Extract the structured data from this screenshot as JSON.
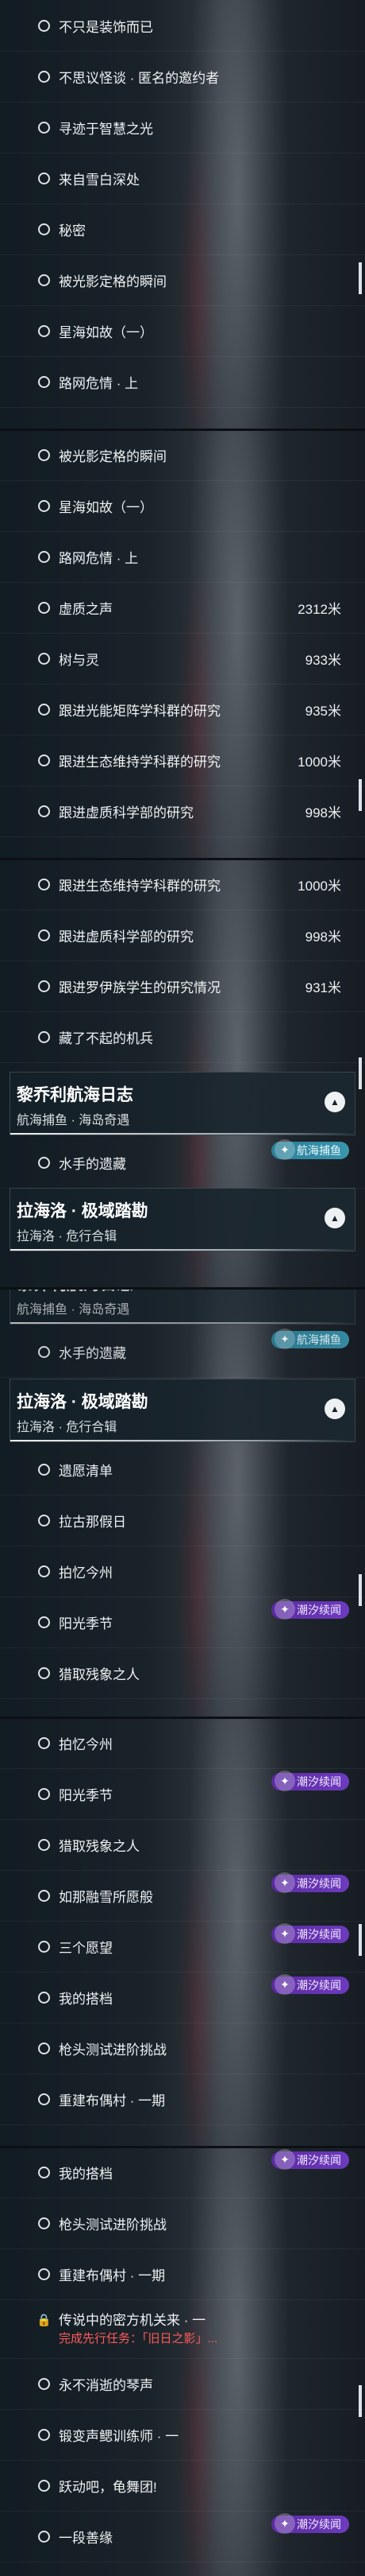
{
  "screens": [
    {
      "items": [
        {
          "label": "不只是装饰而已"
        },
        {
          "label": "不思议怪谈 · 匿名的邀约者"
        },
        {
          "label": "寻迹于智慧之光"
        },
        {
          "label": "来自雪白深处"
        },
        {
          "label": "秘密"
        },
        {
          "label": "被光影定格的瞬间"
        },
        {
          "label": "星海如故（一）"
        },
        {
          "label": "路网危情 · 上"
        }
      ]
    },
    {
      "items": [
        {
          "label": "被光影定格的瞬间"
        },
        {
          "label": "星海如故（一）"
        },
        {
          "label": "路网危情 · 上"
        },
        {
          "label": "虚质之声",
          "distance": "2312米"
        },
        {
          "label": "树与灵",
          "distance": "933米"
        },
        {
          "label": "跟进光能矩阵学科群的研究",
          "distance": "935米"
        },
        {
          "label": "跟进生态维持学科群的研究",
          "distance": "1000米"
        },
        {
          "label": "跟进虚质科学部的研究",
          "distance": "998米"
        }
      ]
    },
    {
      "items": [
        {
          "label": "跟进生态维持学科群的研究",
          "distance": "1000米"
        },
        {
          "label": "跟进虚质科学部的研究",
          "distance": "998米"
        },
        {
          "label": "跟进罗伊族学生的研究情况",
          "distance": "931米"
        },
        {
          "label": "藏了不起的机兵"
        }
      ],
      "header": {
        "title": "黎乔利航海日志",
        "subtitle": "航海捕鱼 · 海岛奇遇"
      },
      "after": [
        {
          "label": "水手的遗藏",
          "badge": "航海捕鱼"
        }
      ],
      "header2": {
        "title": "拉海洛 · 极域踏勘",
        "subtitle": "拉海洛 · 危行合辑"
      }
    },
    {
      "ghost_header": {
        "title": "黎乔利航海日志",
        "subtitle": "航海捕鱼 · 海岛奇遇"
      },
      "ghost_item": {
        "label": "水手的遗藏",
        "badge": "航海捕鱼"
      },
      "header": {
        "title": "拉海洛 · 极域踏勘",
        "subtitle": "拉海洛 · 危行合辑"
      },
      "items": [
        {
          "label": "遗愿清单"
        },
        {
          "label": "拉古那假日"
        },
        {
          "label": "拍忆今州"
        },
        {
          "label": "阳光季节",
          "badge": "潮汐续闻"
        },
        {
          "label": "猎取残象之人"
        }
      ]
    },
    {
      "items": [
        {
          "label": "拍忆今州"
        },
        {
          "label": "阳光季节",
          "badge": "潮汐续闻"
        },
        {
          "label": "猎取残象之人"
        },
        {
          "label": "如那融雪所愿般",
          "badge": "潮汐续闻"
        },
        {
          "label": "三个愿望",
          "badge": "潮汐续闻"
        },
        {
          "label": "我的搭档",
          "badge": "潮汐续闻"
        },
        {
          "label": "枪头测试进阶挑战"
        },
        {
          "label": "重建布偶村 · 一期"
        }
      ]
    },
    {
      "items": [
        {
          "label": "我的搭档",
          "badge": "潮汐续闻"
        },
        {
          "label": "枪头测试进阶挑战"
        },
        {
          "label": "重建布偶村 · 一期"
        },
        {
          "label": "传说中的密方机关来 · 一",
          "locked": true,
          "sub": "完成先行任务：「旧日之影」..."
        },
        {
          "label": "永不消逝的琴声"
        },
        {
          "label": "锻变声鳃训练师 · 一"
        },
        {
          "label": "跃动吧，龟舞团!"
        },
        {
          "label": "一段善缘",
          "badge": "潮汐续闻"
        }
      ]
    }
  ],
  "colors": {
    "badge_purple": "#6d3bbf",
    "badge_teal": "#3a96ad",
    "locked_text": "#ff5a5a"
  },
  "icons": {
    "radio": "radio-circle-icon",
    "lock": "lock-icon",
    "chevron": "chevron-up-icon",
    "badge": "badge-emblem-icon"
  }
}
